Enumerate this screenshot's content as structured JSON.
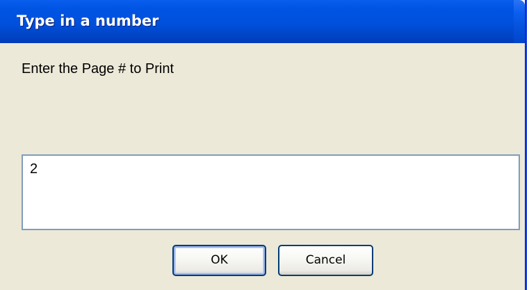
{
  "dialog": {
    "title": "Type in a number",
    "prompt": "Enter the Page # to Print",
    "input_value": "2",
    "ok_label": "OK",
    "cancel_label": "Cancel"
  },
  "colors": {
    "title_bar": "#0054E3",
    "dialog_background": "#ECE9D8",
    "input_border": "#7F9DB9",
    "button_border": "#003C74"
  }
}
